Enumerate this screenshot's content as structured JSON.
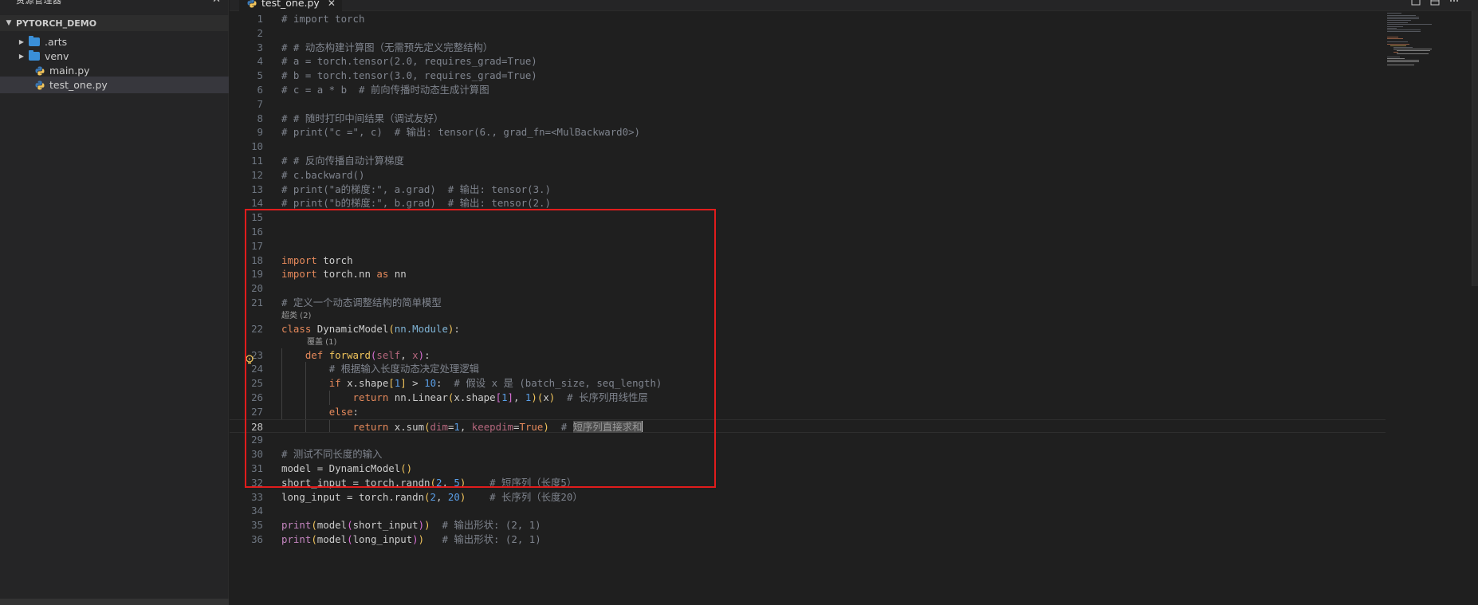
{
  "sidebar": {
    "title": "资源管理器",
    "more_label": "···",
    "close_label": "✕",
    "project": "PYTORCH_DEMO",
    "items": [
      {
        "label": ".arts",
        "type": "folder",
        "chevron": "▶"
      },
      {
        "label": "venv",
        "type": "folder",
        "chevron": "▶"
      },
      {
        "label": "main.py",
        "type": "python-file"
      },
      {
        "label": "test_one.py",
        "type": "python-file",
        "selected": true
      }
    ]
  },
  "tabs": {
    "active_label": "test_one.py",
    "close_label": "✕"
  },
  "editor": {
    "current_line": 28,
    "codelens_superclass": "超类 (2)",
    "codelens_override": "覆盖 (1)",
    "line_numbers": [
      "1",
      "2",
      "3",
      "4",
      "5",
      "6",
      "7",
      "8",
      "9",
      "10",
      "11",
      "12",
      "13",
      "14",
      "15",
      "16",
      "17",
      "18",
      "19",
      "20",
      "21",
      "22",
      "23",
      "24",
      "25",
      "26",
      "27",
      "28",
      "29",
      "30",
      "31",
      "32",
      "33",
      "34",
      "35",
      "36"
    ],
    "selected_comment_text": "短序列直接求和"
  },
  "colors": {
    "highlight_box": "#e01c1c",
    "folder": "#3a8fd8",
    "python_icon_blue": "#3b78b5",
    "python_icon_yellow": "#f2c55c"
  }
}
